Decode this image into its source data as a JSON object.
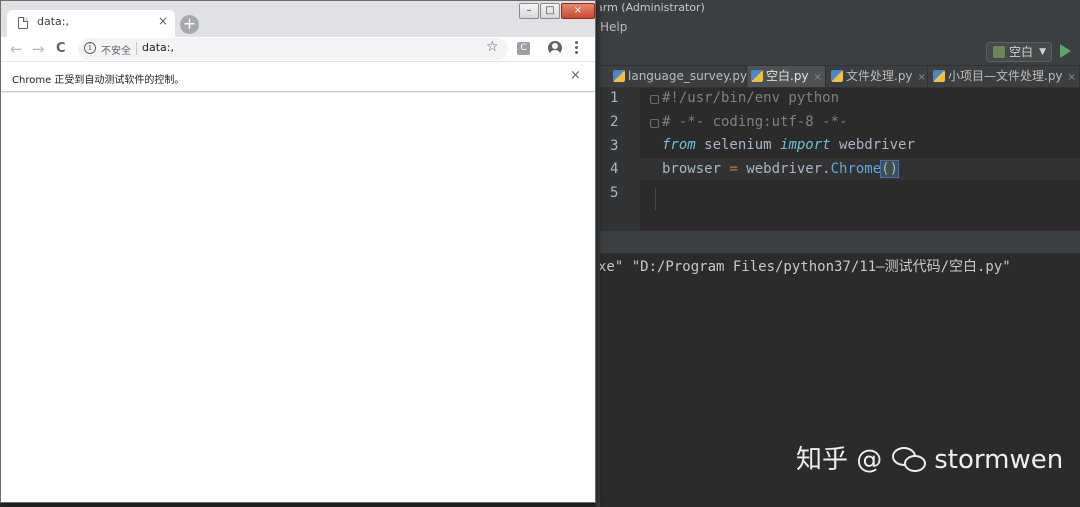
{
  "ide": {
    "title": "arm (Administrator)",
    "menu_help": "Help",
    "run_config": "空白",
    "tabs": [
      {
        "label": "language_survey.py",
        "close": "×"
      },
      {
        "label": "空白.py",
        "close": "×"
      },
      {
        "label": "文件处理.py",
        "close": "×"
      },
      {
        "label": "小项目—文件处理.py",
        "close": "×"
      }
    ],
    "line_numbers": [
      "1",
      "2",
      "3",
      "4",
      "5"
    ],
    "code": {
      "line1": "#!/usr/bin/env python",
      "line2": "# -*- coding:utf-8 -*-",
      "line3_kw1": "from",
      "line3_mod": " selenium ",
      "line3_kw2": "import",
      "line3_name": " webdriver",
      "line4_var": "browser ",
      "line4_eq": "=",
      "line4_obj": " webdriver.",
      "line4_call": "Chrome",
      "line4_parens": "()"
    },
    "console_output": "xe\" \"D:/Program Files/python37/11—测试代码/空白.py\""
  },
  "chrome": {
    "tab_title": "data:,",
    "tab_close": "×",
    "new_tab": "+",
    "window_buttons": [
      "–",
      "□",
      "×"
    ],
    "nav_back": "←",
    "nav_forward": "→",
    "nav_reload": "C",
    "info_icon": "i",
    "security_label": "不安全",
    "url": "data:,",
    "bookmark_star": "☆",
    "extension_label": "C",
    "infobar_message": "Chrome 正受到自动测试软件的控制。",
    "infobar_close": "×"
  },
  "watermark": {
    "prefix": "知乎 @",
    "name": "stormwen"
  },
  "colors": {
    "ide_bg": "#2b2b2b",
    "ide_chrome": "#3c3f41",
    "keyword": "#cc7832",
    "comment": "#808080",
    "run_green": "#59a869",
    "chrome_frame": "#dfe1e5"
  },
  "icons": {
    "page": "page-icon",
    "info": "info-icon",
    "star": "star-icon",
    "profile": "profile-icon",
    "menu": "menu-icon",
    "run": "run-icon",
    "python_file": "python-file-icon"
  }
}
